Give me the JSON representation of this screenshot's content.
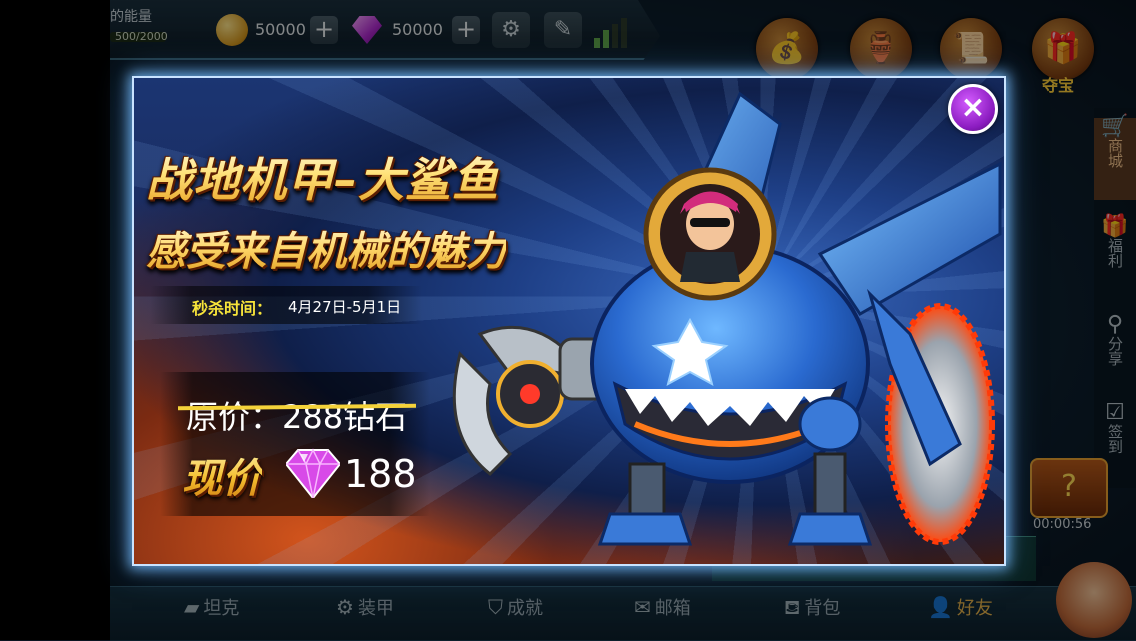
{
  "topbar": {
    "energy_label": "的能量",
    "energy_value": "500/2000",
    "gold_amount": "50000",
    "gem_amount": "50000",
    "plus": "+",
    "icons": [
      "coin-icon",
      "gem-icon",
      "settings-icon",
      "notepad-icon",
      "signal-icon"
    ],
    "orb_label": "夺宝"
  },
  "sidebar": {
    "items": [
      {
        "label": "商城",
        "icon": "cart-icon"
      },
      {
        "label": "福利",
        "icon": "gift-icon"
      },
      {
        "label": "分享",
        "icon": "share-icon"
      },
      {
        "label": "签到",
        "icon": "calendar-check-icon"
      }
    ],
    "timer": "00:00:56"
  },
  "bottom_nav": {
    "items": [
      {
        "label": "坦克",
        "icon": "tank-icon"
      },
      {
        "label": "装甲",
        "icon": "armor-icon"
      },
      {
        "label": "成就",
        "icon": "achievement-icon"
      },
      {
        "label": "邮箱",
        "icon": "mail-icon"
      },
      {
        "label": "背包",
        "icon": "backpack-icon"
      },
      {
        "label": "好友",
        "icon": "friends-icon"
      }
    ]
  },
  "popup": {
    "title": "战地机甲–大鲨鱼",
    "subtitle": "感受来自机械的魅力",
    "flash_sale_label": "秒杀时间：",
    "flash_sale_dates": "4月27日-5月1日",
    "original_price": "原价：288钻石",
    "current_price_label": "现价",
    "current_price": "188",
    "close_symbol": "×"
  },
  "colors": {
    "accent_gold": "#f4c030",
    "close_purple": "#8b1cc0",
    "flash_yellow": "#f7e43a",
    "popup_border": "#c9e3ff"
  }
}
